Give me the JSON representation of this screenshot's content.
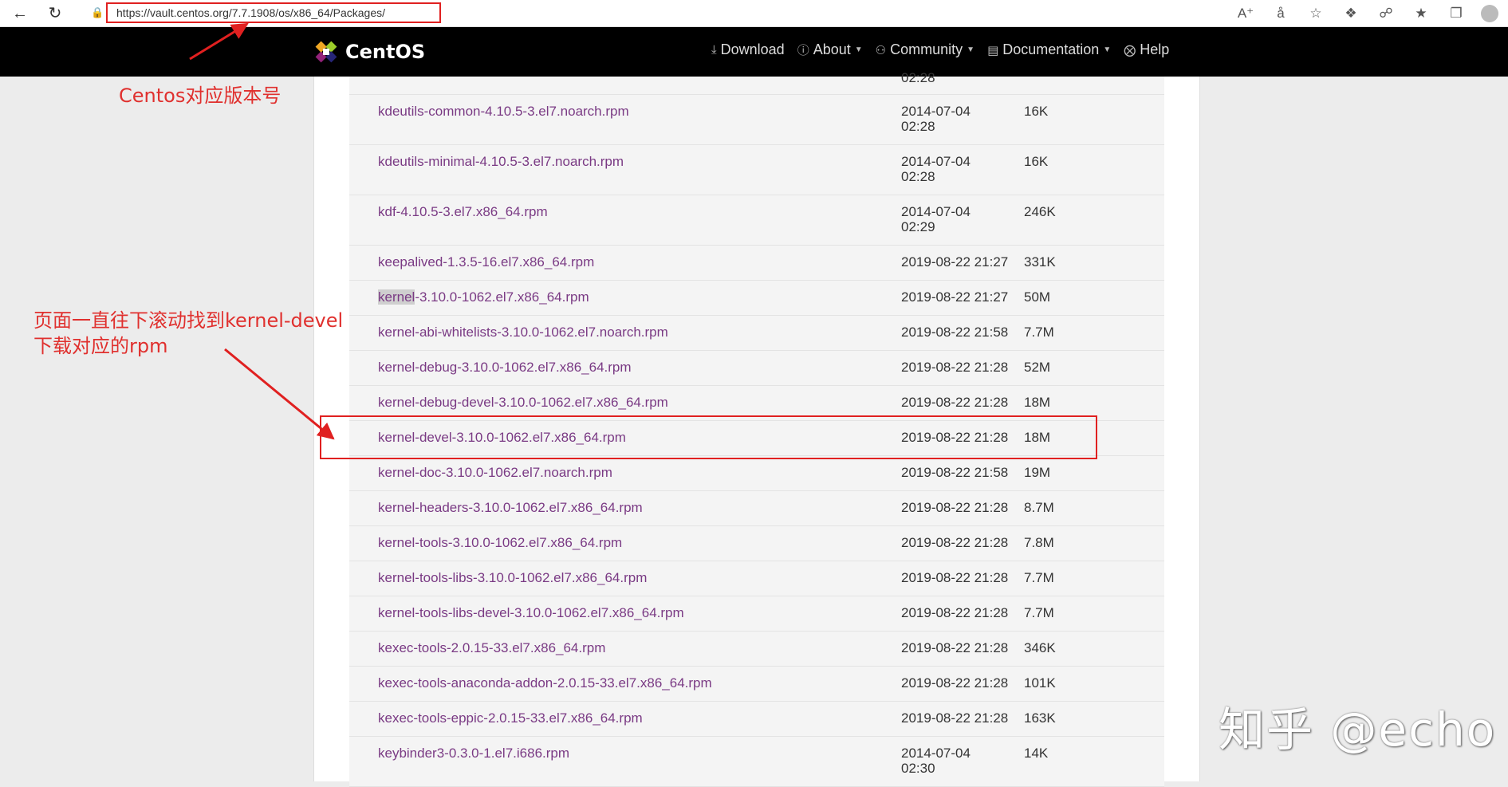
{
  "browser": {
    "url": "https://vault.centos.org/7.7.1908/os/x86_64/Packages/",
    "icons": [
      "back-icon",
      "reload-icon",
      "read-aloud-icon",
      "translate-icon",
      "favorite-star-icon",
      "extension-icon",
      "puzzle-icon",
      "favorites-icon",
      "collections-icon",
      "profile-icon"
    ]
  },
  "site": {
    "logo_text": "CentOS",
    "menu": [
      {
        "label": "Download",
        "icon": "download-icon",
        "caret": false
      },
      {
        "label": "About",
        "icon": "info-icon",
        "caret": true
      },
      {
        "label": "Community",
        "icon": "users-icon",
        "caret": true
      },
      {
        "label": "Documentation",
        "icon": "book-icon",
        "caret": true
      },
      {
        "label": "Help",
        "icon": "help-icon",
        "caret": false
      }
    ]
  },
  "partial_row": {
    "date_tail": "02:28"
  },
  "rows": [
    {
      "name": "kdeutils-common-4.10.5-3.el7.noarch.rpm",
      "date_line1": "2014-07-04",
      "date_line2": "02:28",
      "size": "16K"
    },
    {
      "name": "kdeutils-minimal-4.10.5-3.el7.noarch.rpm",
      "date_line1": "2014-07-04",
      "date_line2": "02:28",
      "size": "16K"
    },
    {
      "name": "kdf-4.10.5-3.el7.x86_64.rpm",
      "date_line1": "2014-07-04",
      "date_line2": "02:29",
      "size": "246K"
    },
    {
      "name": "keepalived-1.3.5-16.el7.x86_64.rpm",
      "date_line1": "2019-08-22 21:27",
      "date_line2": "",
      "size": "331K"
    },
    {
      "name_prefix": "kernel",
      "name": "-3.10.0-1062.el7.x86_64.rpm",
      "date_line1": "2019-08-22 21:27",
      "date_line2": "",
      "size": "50M"
    },
    {
      "name": "kernel-abi-whitelists-3.10.0-1062.el7.noarch.rpm",
      "date_line1": "2019-08-22 21:58",
      "date_line2": "",
      "size": "7.7M"
    },
    {
      "name": "kernel-debug-3.10.0-1062.el7.x86_64.rpm",
      "date_line1": "2019-08-22 21:28",
      "date_line2": "",
      "size": "52M"
    },
    {
      "name": "kernel-debug-devel-3.10.0-1062.el7.x86_64.rpm",
      "date_line1": "2019-08-22 21:28",
      "date_line2": "",
      "size": "18M"
    },
    {
      "name": "kernel-devel-3.10.0-1062.el7.x86_64.rpm",
      "date_line1": "2019-08-22 21:28",
      "date_line2": "",
      "size": "18M"
    },
    {
      "name": "kernel-doc-3.10.0-1062.el7.noarch.rpm",
      "date_line1": "2019-08-22 21:58",
      "date_line2": "",
      "size": "19M"
    },
    {
      "name": "kernel-headers-3.10.0-1062.el7.x86_64.rpm",
      "date_line1": "2019-08-22 21:28",
      "date_line2": "",
      "size": "8.7M"
    },
    {
      "name": "kernel-tools-3.10.0-1062.el7.x86_64.rpm",
      "date_line1": "2019-08-22 21:28",
      "date_line2": "",
      "size": "7.8M"
    },
    {
      "name": "kernel-tools-libs-3.10.0-1062.el7.x86_64.rpm",
      "date_line1": "2019-08-22 21:28",
      "date_line2": "",
      "size": "7.7M"
    },
    {
      "name": "kernel-tools-libs-devel-3.10.0-1062.el7.x86_64.rpm",
      "date_line1": "2019-08-22 21:28",
      "date_line2": "",
      "size": "7.7M"
    },
    {
      "name": "kexec-tools-2.0.15-33.el7.x86_64.rpm",
      "date_line1": "2019-08-22 21:28",
      "date_line2": "",
      "size": "346K"
    },
    {
      "name": "kexec-tools-anaconda-addon-2.0.15-33.el7.x86_64.rpm",
      "date_line1": "2019-08-22 21:28",
      "date_line2": "",
      "size": "101K"
    },
    {
      "name": "kexec-tools-eppic-2.0.15-33.el7.x86_64.rpm",
      "date_line1": "2019-08-22 21:28",
      "date_line2": "",
      "size": "163K"
    },
    {
      "name": "keybinder3-0.3.0-1.el7.i686.rpm",
      "date_line1": "2014-07-04",
      "date_line2": "02:30",
      "size": "14K"
    }
  ],
  "annotations": {
    "version_note": "Centos对应版本号",
    "scroll_note_line1": "页面一直往下滚动找到kernel-devel",
    "scroll_note_line2": "下载对应的rpm",
    "color": "#e0302e"
  },
  "watermark": "知乎 @echo"
}
